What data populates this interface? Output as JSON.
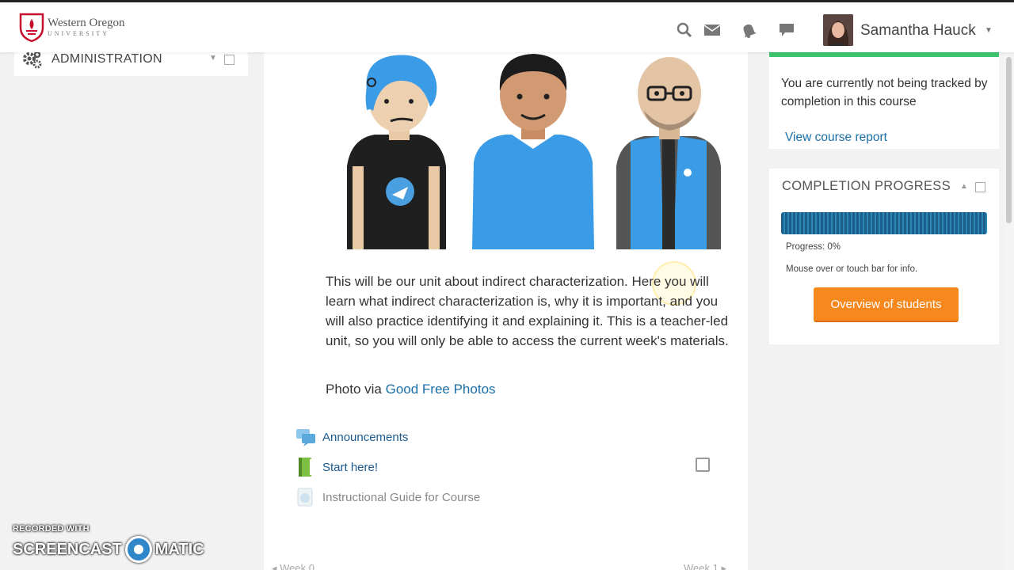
{
  "header": {
    "logo_line1": "Western Oregon",
    "logo_line2": "UNIVERSITY",
    "user_name": "Samantha Hauck",
    "icons": [
      "search-icon",
      "mail-icon",
      "bell-icon",
      "chat-icon"
    ]
  },
  "sidebar_left": {
    "admin_title": "ADMINISTRATION"
  },
  "main": {
    "intro_text": "This will be our unit about indirect characterization. Here you will learn what indirect characterization is, why it is important, and you will also practice identifying it and explaining it. This is a teacher-led unit, so you will only be able to access the current week's materials.",
    "photo_prefix": "Photo via ",
    "photo_link": "Good Free Photos",
    "activities": [
      {
        "label": "Announcements",
        "icon": "forum-icon"
      },
      {
        "label": "Start here!",
        "icon": "book-icon"
      },
      {
        "label": "Instructional Guide for Course",
        "icon": "page-icon"
      }
    ],
    "nav_prev": "◂ Week 0",
    "nav_next": "Week 1 ▸"
  },
  "right": {
    "tracking_text": "You are currently not being tracked by completion in this course",
    "course_report": "View course report",
    "progress_title": "COMPLETION PROGRESS",
    "progress_text": "Progress: 0%",
    "progress_value": 0,
    "progress_info": "Mouse over or touch bar for info.",
    "overview_button": "Overview of students"
  },
  "watermark": {
    "top": "RECORDED WITH",
    "left": "SCREENCAST",
    "right": "MATIC"
  },
  "colors": {
    "accent_orange": "#f7881d",
    "link_blue": "#1a6fa8",
    "tracking_green": "#3ec46d",
    "brand_red": "#c8102e"
  }
}
